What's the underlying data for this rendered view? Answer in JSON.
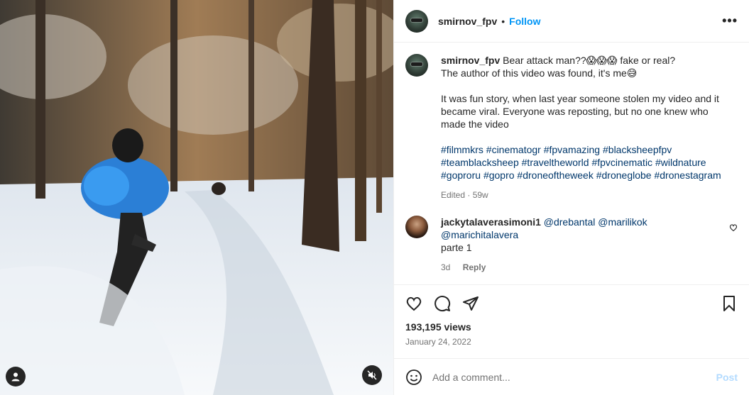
{
  "post": {
    "username": "smirnov_fpv",
    "follow_label": "Follow",
    "separator": "•",
    "more_label": "•••"
  },
  "caption": {
    "username": "smirnov_fpv",
    "line1": "Bear attack man??😱😱😱 fake or real?",
    "line2": "The author of this video was found, it's me😅",
    "paragraph": "It was fun story, when last year someone stolen my video and it became viral. Everyone was reposting, but no one knew who made the video",
    "hashtags": [
      "#filmmkrs",
      "#cinematogr",
      "#fpvamazing",
      "#blacksheepfpv",
      "#teamblacksheep",
      "#traveltheworld",
      "#fpvcinematic",
      "#wildnature",
      "#goproru",
      "#gopro",
      "#droneoftheweek",
      "#droneglobe",
      "#dronestagram"
    ],
    "meta": "Edited · 59w"
  },
  "comment": {
    "username": "jackytalaverasimoni1",
    "mentions": "@drebantal @marilikok @marichitalavera",
    "text": "parte 1",
    "age": "3d",
    "reply_label": "Reply"
  },
  "stats": {
    "views": "193,195 views",
    "date": "January 24, 2022"
  },
  "composer": {
    "placeholder": "Add a comment...",
    "post_label": "Post"
  },
  "icons": [
    "user-icon",
    "muted-speaker-icon",
    "heart-icon",
    "comment-icon",
    "share-icon",
    "bookmark-icon",
    "emoji-icon",
    "more-icon",
    "small-heart-icon"
  ],
  "colors": {
    "accent": "#0095f6",
    "tag": "#00376b",
    "muted": "#737373",
    "post_disabled": "#b3dbff"
  }
}
